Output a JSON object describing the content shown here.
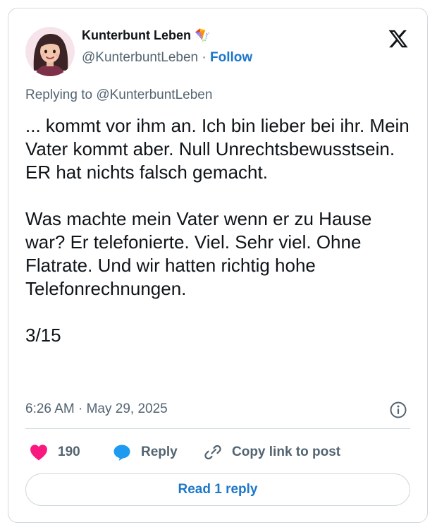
{
  "author": {
    "name": "Kunterbunt Leben 🪁",
    "handle": "@KunterbuntLeben",
    "separator": " · ",
    "follow_label": "Follow",
    "avatar_icon": "avatar-woman-dark-hair-icon"
  },
  "brand": {
    "logo_icon": "x-logo-icon"
  },
  "tweet": {
    "replying_to": "Replying to @KunterbuntLeben",
    "paragraphs": [
      "... kommt vor ihm an. Ich bin lieber bei ihr. Mein Vater kommt aber. Null Unrechtsbewusstsein. ER hat nichts falsch gemacht.",
      "Was machte mein Vater wenn er zu Hause war? Er telefonierte. Viel. Sehr viel. Ohne Flatrate. Und wir hatten richtig hohe Telefonrechnungen.",
      "3/15"
    ],
    "timestamp": "6:26 AM · May 29, 2025"
  },
  "actions": {
    "like_count": "190",
    "reply_label": "Reply",
    "copy_label": "Copy link to post",
    "read_replies_label": "Read 1 reply"
  },
  "colors": {
    "link": "#1d77c9",
    "like": "#f91880",
    "reply": "#1d9bf0",
    "muted": "#536471",
    "border": "#cfd9de"
  }
}
